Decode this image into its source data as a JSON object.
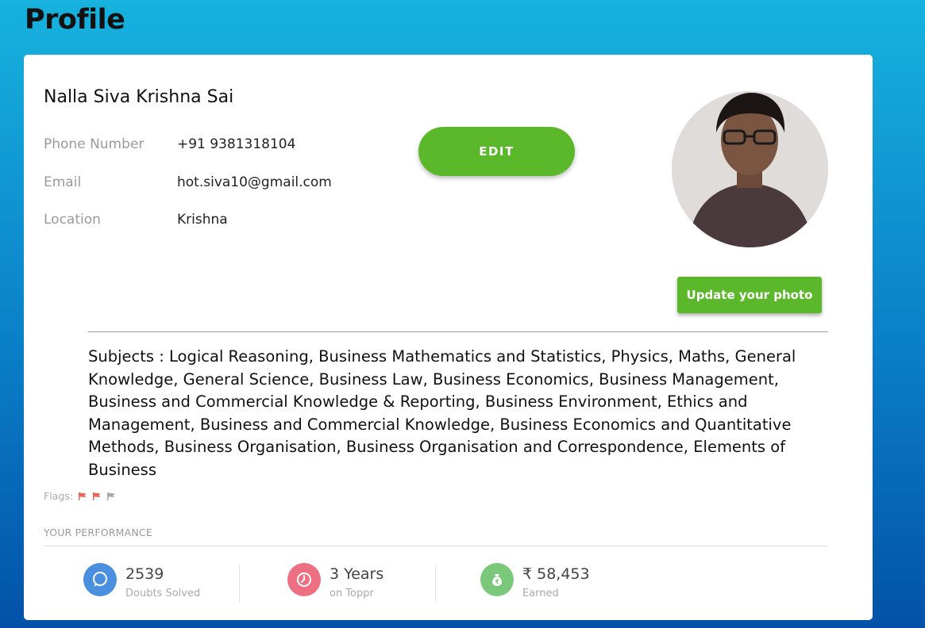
{
  "page": {
    "title": "Profile"
  },
  "profile": {
    "name": "Nalla Siva Krishna Sai",
    "fields": [
      {
        "label": "Phone Number",
        "value": "+91 9381318104"
      },
      {
        "label": "Email",
        "value": "hot.siva10@gmail.com"
      },
      {
        "label": "Location",
        "value": "Krishna"
      }
    ],
    "edit_label": "EDIT",
    "update_photo_label": "Update your photo",
    "subjects": "Subjects : Logical Reasoning, Business Mathematics and Statistics, Physics, Maths, General Knowledge, General Science, Business Law, Business Economics, Business Management, Business and Commercial Knowledge & Reporting, Business Environment, Ethics and Management, Business and Commercial Knowledge, Business Economics and Quantitative Methods, Business Organisation, Business Organisation and Correspondence, Elements of Business",
    "flags_label": "Flags:",
    "flags": [
      {
        "icon": "flag-icon",
        "color": "#e8665c"
      },
      {
        "icon": "flag-icon",
        "color": "#e8665c"
      },
      {
        "icon": "flag-icon",
        "color": "#a9a9a9"
      }
    ]
  },
  "performance": {
    "title": "YOUR PERFORMANCE",
    "stats": [
      {
        "icon": "chat-bubble-icon",
        "color": "#4a8fe0",
        "value": "2539",
        "label": "Doubts Solved"
      },
      {
        "icon": "clock-icon",
        "color": "#ec6f82",
        "value": "3 Years",
        "label": "on Toppr"
      },
      {
        "icon": "money-bag-icon",
        "color": "#7cc87a",
        "value": "₹ 58,453",
        "label": "Earned"
      }
    ]
  },
  "colors": {
    "accent": "#5bb82a",
    "background_top": "#17b2de",
    "background_bottom": "#0352a8"
  }
}
